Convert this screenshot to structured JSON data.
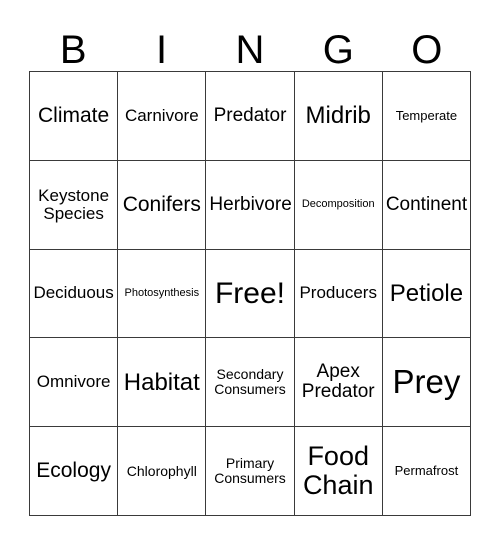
{
  "card": {
    "title_letters": [
      "B",
      "I",
      "N",
      "G",
      "O"
    ],
    "free_space": "Free!",
    "columns": 5,
    "rows": 5,
    "border_color": "#3a3a3a",
    "background_color": "#ffffff",
    "text_color": "#000000",
    "cells": [
      [
        {
          "label": "Climate",
          "size": "fs-xl"
        },
        {
          "label": "Carnivore",
          "size": "fs-md"
        },
        {
          "label": "Predator",
          "size": "fs-lg"
        },
        {
          "label": "Midrib",
          "size": "fs-xxl"
        },
        {
          "label": "Temperate",
          "size": "fs-sm"
        }
      ],
      [
        {
          "label": "Keystone\nSpecies",
          "size": "fs-md"
        },
        {
          "label": "Conifers",
          "size": "fs-xl"
        },
        {
          "label": "Herbivore",
          "size": "fs-lg"
        },
        {
          "label": "Decomposition",
          "size": "fs-xs"
        },
        {
          "label": "Continent",
          "size": "fs-lg"
        }
      ],
      [
        {
          "label": "Deciduous",
          "size": "fs-md"
        },
        {
          "label": "Photosynthesis",
          "size": "fs-xs"
        },
        {
          "label": "Free!",
          "size": "fs-h2"
        },
        {
          "label": "Producers",
          "size": "fs-md"
        },
        {
          "label": "Petiole",
          "size": "fs-xxl"
        }
      ],
      [
        {
          "label": "Omnivore",
          "size": "fs-md"
        },
        {
          "label": "Habitat",
          "size": "fs-xxl"
        },
        {
          "label": "Secondary\nConsumers",
          "size": "fs-smd"
        },
        {
          "label": "Apex\nPredator",
          "size": "fs-lg"
        },
        {
          "label": "Prey",
          "size": "fs-h3"
        }
      ],
      [
        {
          "label": "Ecology",
          "size": "fs-xl"
        },
        {
          "label": "Chlorophyll",
          "size": "fs-smd"
        },
        {
          "label": "Primary\nConsumers",
          "size": "fs-smd"
        },
        {
          "label": "Food\nChain",
          "size": "fs-h1"
        },
        {
          "label": "Permafrost",
          "size": "fs-sm"
        }
      ]
    ]
  }
}
